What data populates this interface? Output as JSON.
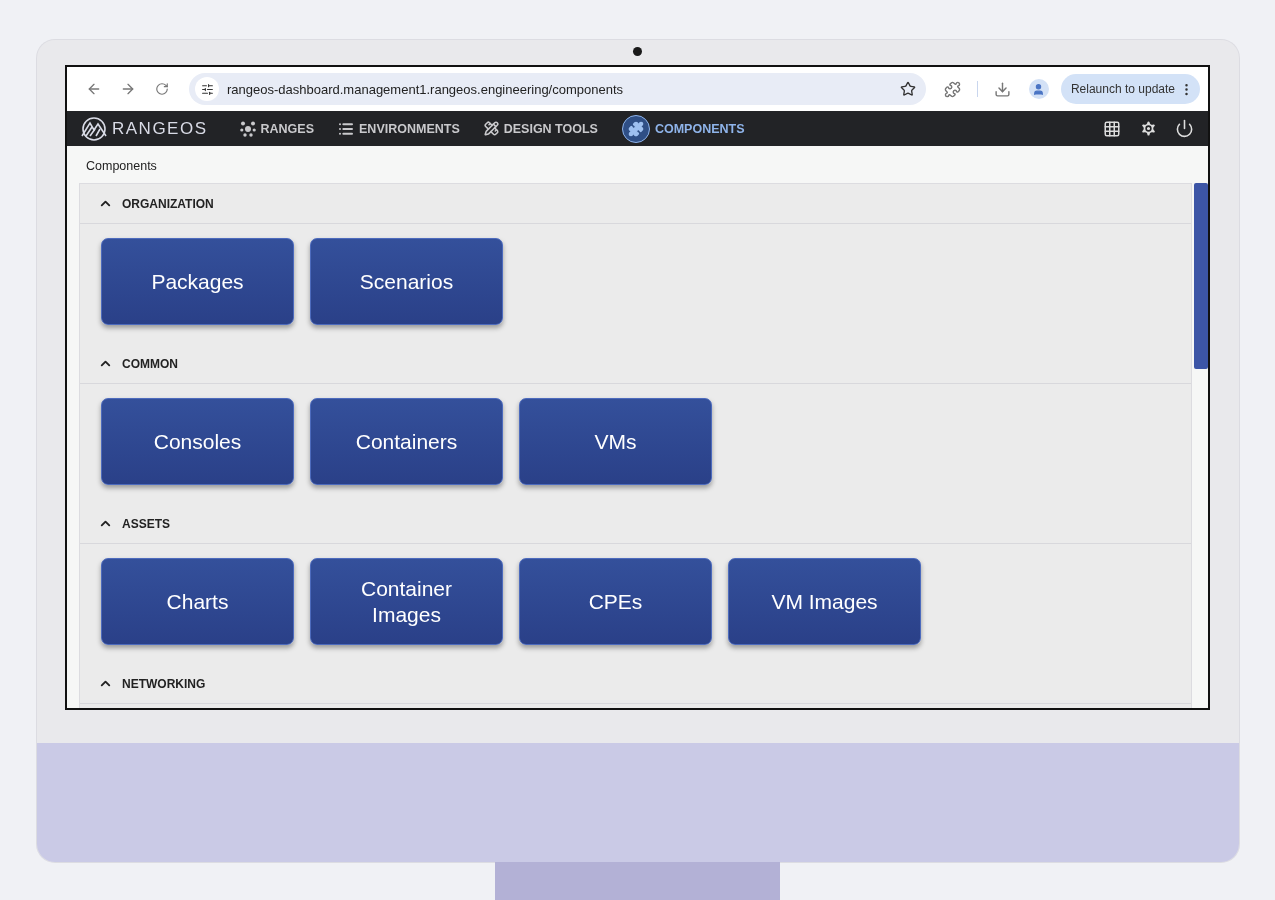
{
  "browser": {
    "url": "rangeos-dashboard.management1.rangeos.engineering/components",
    "relaunch_label": "Relaunch to update"
  },
  "app": {
    "logo": "RANGEOS",
    "nav": [
      {
        "label": "RANGES",
        "kind": "ranges",
        "selected": false
      },
      {
        "label": "ENVIRONMENTS",
        "kind": "environments",
        "selected": false
      },
      {
        "label": "DESIGN TOOLS",
        "kind": "design",
        "selected": false
      },
      {
        "label": "COMPONENTS",
        "kind": "components",
        "selected": true
      }
    ]
  },
  "breadcrumb": "Components",
  "sections": [
    {
      "title": "ORGANIZATION",
      "expanded": true,
      "items": [
        "Packages",
        "Scenarios"
      ]
    },
    {
      "title": "COMMON",
      "expanded": true,
      "items": [
        "Consoles",
        "Containers",
        "VMs"
      ]
    },
    {
      "title": "ASSETS",
      "expanded": true,
      "items": [
        "Charts",
        "Container Images",
        "CPEs",
        "VM Images"
      ]
    },
    {
      "title": "NETWORKING",
      "expanded": true
    }
  ]
}
